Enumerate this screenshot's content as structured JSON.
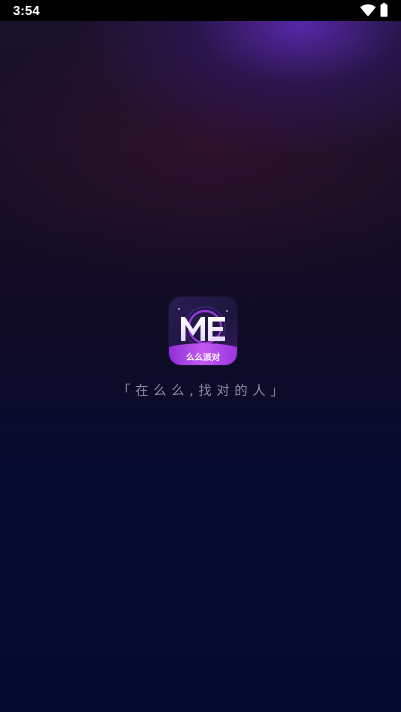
{
  "status_bar": {
    "time": "3:54",
    "icons": [
      "wifi-icon",
      "battery-icon"
    ]
  },
  "splash": {
    "logo_icon": "app-logo-icon",
    "logo_text": "ME",
    "logo_caption": "么么派对",
    "slogan": "「在么么,找对的人」"
  },
  "colors": {
    "background_top": "#1a1228",
    "background_bottom": "#040a2e",
    "accent_purple": "#7a2fd6",
    "logo_band": "#b44be8",
    "slogan_text": "#8f8fa3"
  }
}
